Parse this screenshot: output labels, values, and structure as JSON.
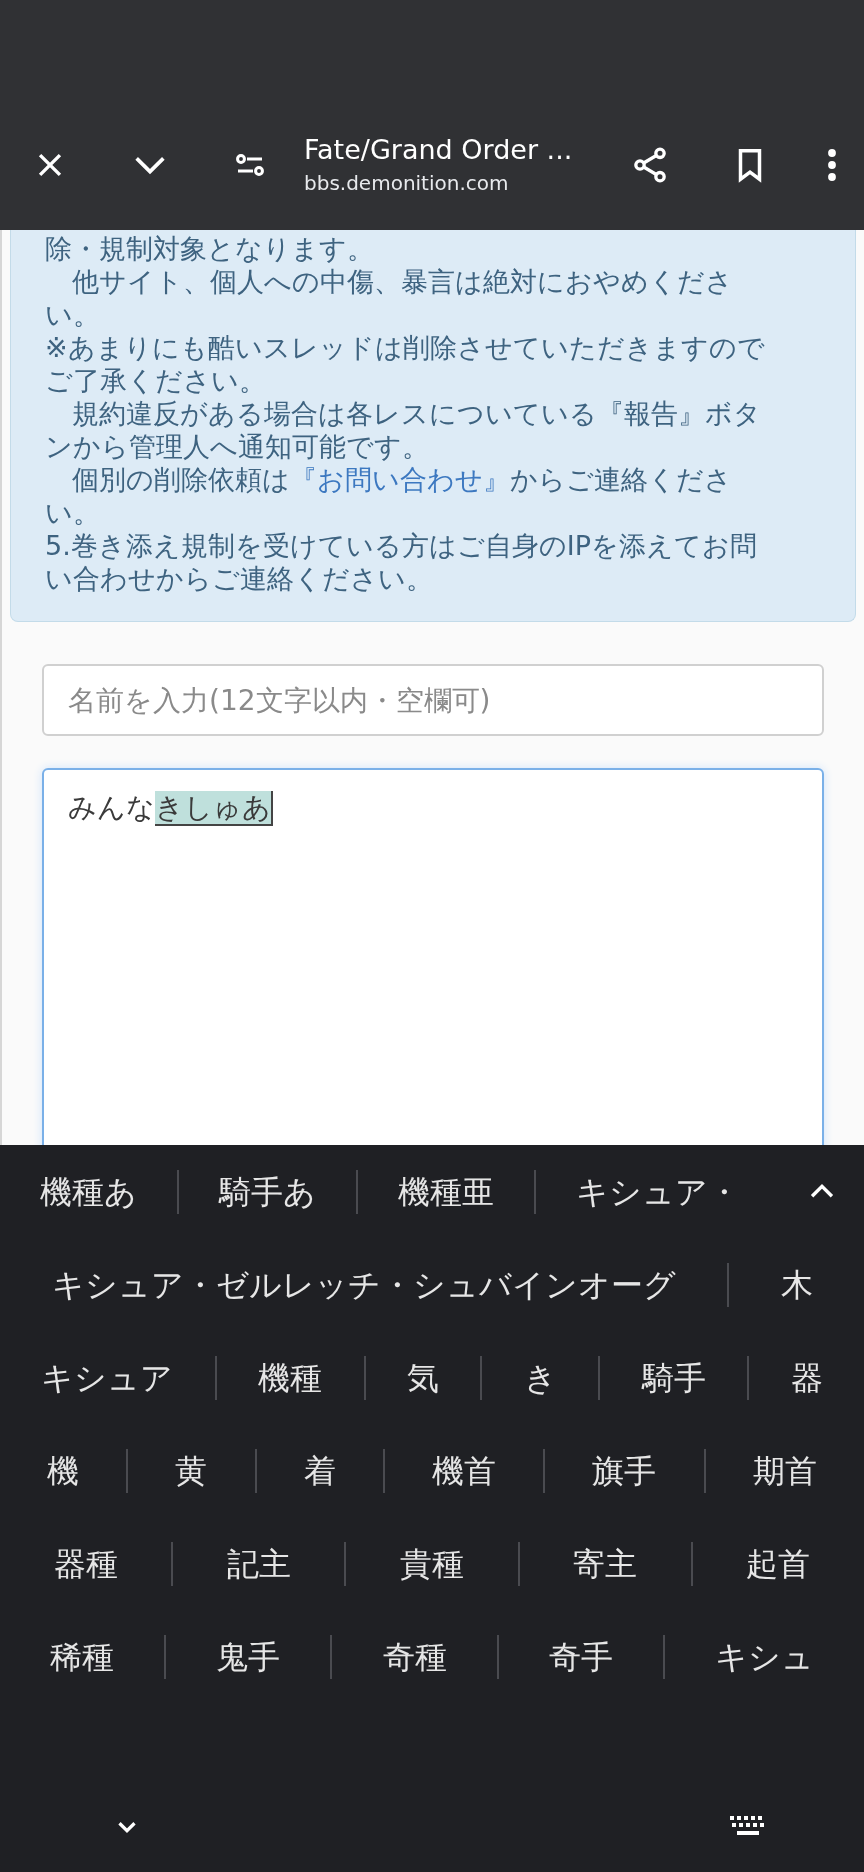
{
  "toolbar": {
    "title": "Fate/Grand Order ...",
    "url": "bbs.demonition.com"
  },
  "notice": {
    "lines": [
      {
        "kind": "plain",
        "text": "除・規制対象となります。"
      },
      {
        "kind": "plain",
        "text": "　他サイト、個人への中傷、暴言は絶対におやめくださ"
      },
      {
        "kind": "plain",
        "text": "い。"
      },
      {
        "kind": "plain",
        "text": "※あまりにも酷いスレッドは削除させていただきますので"
      },
      {
        "kind": "plain",
        "text": "ご了承ください。"
      },
      {
        "kind": "plain",
        "text": "　規約違反がある場合は各レスについている『報告』ボタ"
      },
      {
        "kind": "plain",
        "text": "ンから管理人へ通知可能です。"
      },
      {
        "kind": "linked",
        "before": "　個別の削除依頼は",
        "link": "『お問い合わせ』",
        "after": "からご連絡くださ"
      },
      {
        "kind": "plain",
        "text": "い。"
      },
      {
        "kind": "plain",
        "text": "5.巻き添え規制を受けている方はご自身のIPを添えてお問"
      },
      {
        "kind": "plain",
        "text": "い合わせからご連絡ください。"
      }
    ]
  },
  "name_field": {
    "placeholder": "名前を入力(12文字以内・空欄可)"
  },
  "message_field": {
    "value": "みんな",
    "composing": "きしゅあ"
  },
  "candidates": [
    [
      "機種あ",
      "騎手あ",
      "機種亜",
      "キシュア・"
    ],
    [
      "キシュア・ゼルレッチ・シュバインオーグ",
      "木"
    ],
    [
      "キシュア",
      "機種",
      "気",
      "き",
      "騎手",
      "器"
    ],
    [
      "機",
      "黄",
      "着",
      "機首",
      "旗手",
      "期首"
    ],
    [
      "器種",
      "記主",
      "貴種",
      "寄主",
      "起首"
    ],
    [
      "稀種",
      "鬼手",
      "奇種",
      "奇手",
      "キシュ"
    ]
  ]
}
